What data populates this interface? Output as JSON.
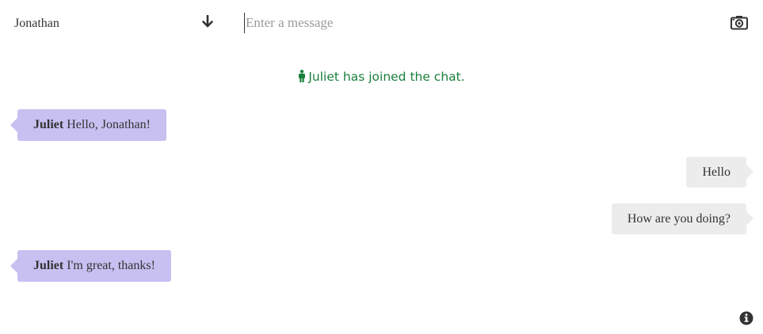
{
  "user_select": {
    "selected": "Jonathan",
    "icon": "arrow-down-icon"
  },
  "composer": {
    "placeholder": "Enter a message",
    "value": "",
    "camera_icon": "camera-icon"
  },
  "system_message": {
    "icon": "person-icon",
    "text": "Juliet has joined the chat."
  },
  "messages": [
    {
      "direction": "incoming",
      "sender": "Juliet",
      "text": "Hello, Jonathan!"
    },
    {
      "direction": "outgoing",
      "sender": "",
      "text": "Hello"
    },
    {
      "direction": "outgoing",
      "sender": "",
      "text": "How are you doing?"
    },
    {
      "direction": "incoming",
      "sender": "Juliet",
      "text": "I'm great, thanks!"
    }
  ],
  "footer": {
    "info_icon": "info-icon"
  },
  "colors": {
    "incoming_bubble": "#c7c0f1",
    "outgoing_bubble": "#ececec",
    "system_text": "#1a7f3c"
  }
}
